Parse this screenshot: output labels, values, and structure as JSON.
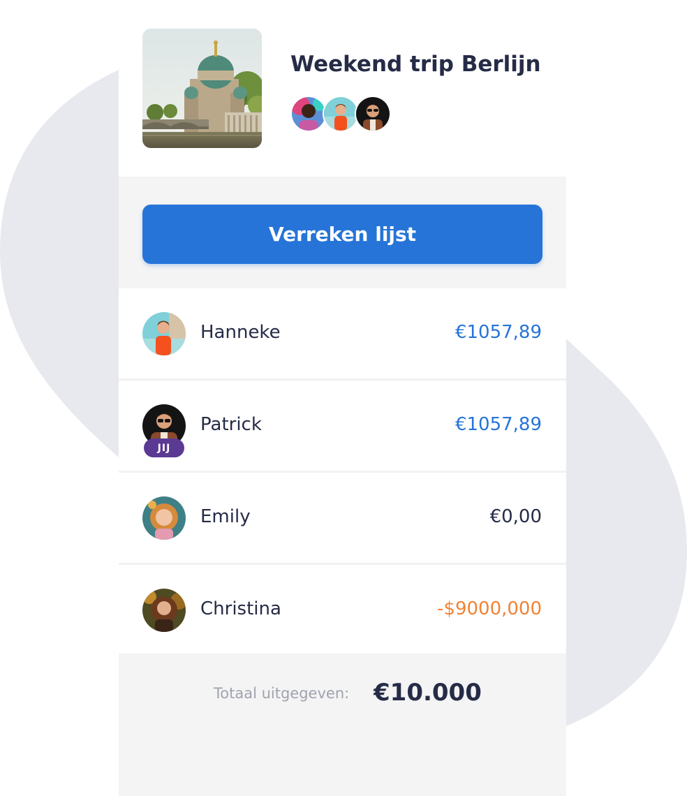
{
  "trip": {
    "title": "Weekend trip Berlijn"
  },
  "actions": {
    "settle_label": "Verreken lijst"
  },
  "members": [
    {
      "name": "Hanneke",
      "amount": "€1057,89",
      "badge": ""
    },
    {
      "name": "Patrick",
      "amount": "€1057,89",
      "badge": "JIJ"
    },
    {
      "name": "Emily",
      "amount": "€0,00",
      "badge": ""
    },
    {
      "name": "Christina",
      "amount": "-$9000,000",
      "badge": ""
    }
  ],
  "totals": {
    "label": "Totaal uitgegeven:",
    "value": "€10.000"
  },
  "colors": {
    "brand": "#2674d8",
    "positive": "#2674d8",
    "neutral": "#262b47",
    "negative": "#f08234",
    "badge": "#5b3a93",
    "band": "#f4f4f5",
    "backdrop": "#e8e9ee"
  }
}
